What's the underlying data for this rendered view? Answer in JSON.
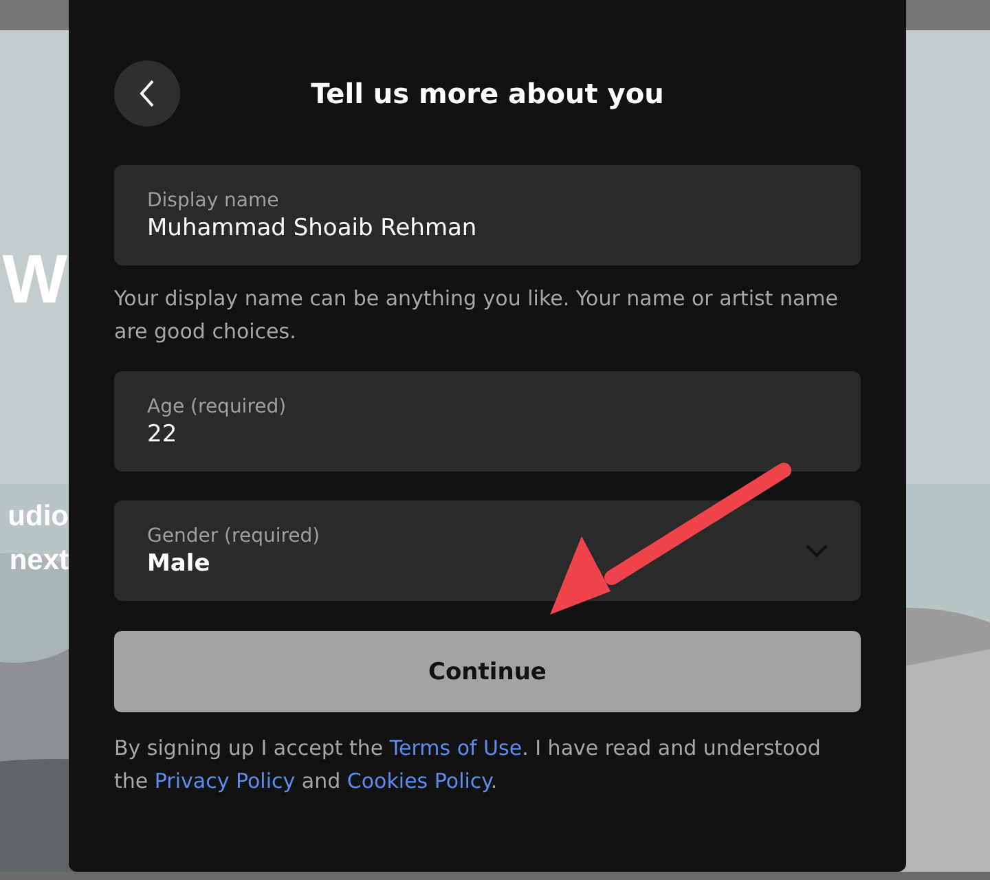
{
  "background_texts": [
    {
      "text": "W",
      "kind": "heading"
    },
    {
      "text": "udio",
      "kind": "line"
    },
    {
      "text": "next",
      "kind": "line"
    }
  ],
  "dialog": {
    "title": "Tell us more about you",
    "fields": [
      {
        "kind": "text",
        "label": "Display name",
        "value": "Muhammad Shoaib Rehman",
        "help": "Your display name can be anything you like. Your name or artist name are good choices."
      },
      {
        "kind": "text",
        "label": "Age (required)",
        "value": "22"
      },
      {
        "kind": "select",
        "label": "Gender (required)",
        "value": "Male"
      }
    ],
    "continue_button": "Continue",
    "legal": [
      {
        "kind": "text",
        "text": "By signing up I accept the "
      },
      {
        "kind": "link",
        "text": "Terms of Use"
      },
      {
        "kind": "text",
        "text": ". I have read and understood the "
      },
      {
        "kind": "link",
        "text": "Privacy Policy"
      },
      {
        "kind": "text",
        "text": " and "
      },
      {
        "kind": "link",
        "text": "Cookies Policy"
      },
      {
        "kind": "text",
        "text": "."
      }
    ]
  },
  "annotations": [
    {
      "kind": "arrow"
    }
  ]
}
